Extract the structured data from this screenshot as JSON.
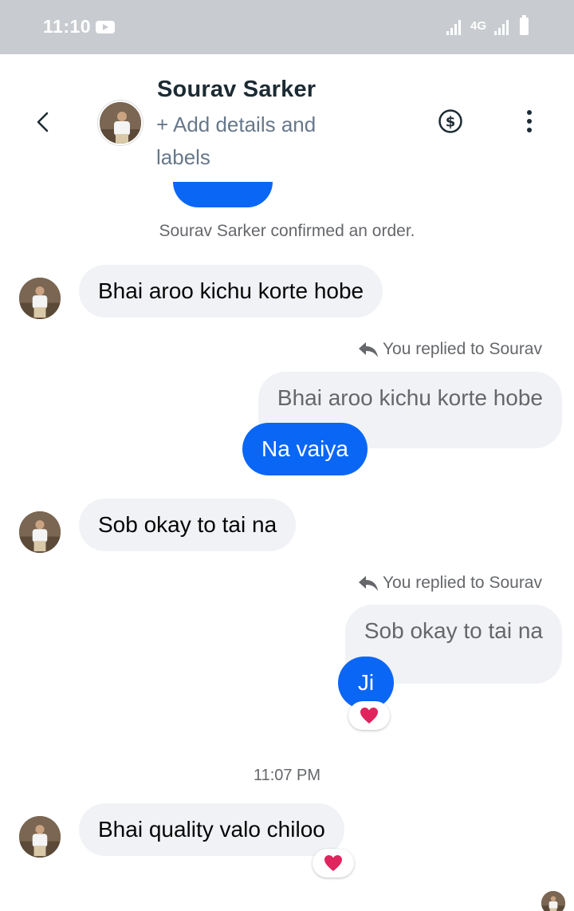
{
  "status_bar": {
    "time": "11:10",
    "network": "4G",
    "icons": [
      "youtube-icon",
      "signal-icon",
      "network-4g-icon",
      "signal-icon",
      "battery-icon"
    ]
  },
  "header": {
    "name": "Sourav Sarker",
    "subtitle": "+ Add details and labels",
    "icons": [
      "back-arrow-icon",
      "dollar-circle-icon",
      "more-vertical-icon"
    ]
  },
  "chat": {
    "system_message": "Sourav Sarker confirmed an order.",
    "messages": [
      {
        "from": "contact",
        "text": "Bhai aroo kichu korte hobe"
      },
      {
        "from": "me",
        "reply_note": "You replied to Sourav",
        "quoted": "Bhai aroo kichu korte hobe",
        "text": "Na vaiya"
      },
      {
        "from": "contact",
        "text": "Sob okay to tai na"
      },
      {
        "from": "me",
        "reply_note": "You replied to Sourav",
        "quoted": "Sob okay to tai na",
        "text": "Ji",
        "reaction": "heart"
      },
      {
        "from": "contact",
        "text": "Bhai quality valo chiloo",
        "reaction": "heart"
      }
    ],
    "timestamp": "11:07 PM"
  },
  "colors": {
    "accent_blue": "#0a66f5",
    "bubble_gray": "#f0f2f5",
    "status_bar_gray": "#c8cbcf",
    "heart_red": "#e0245e"
  }
}
